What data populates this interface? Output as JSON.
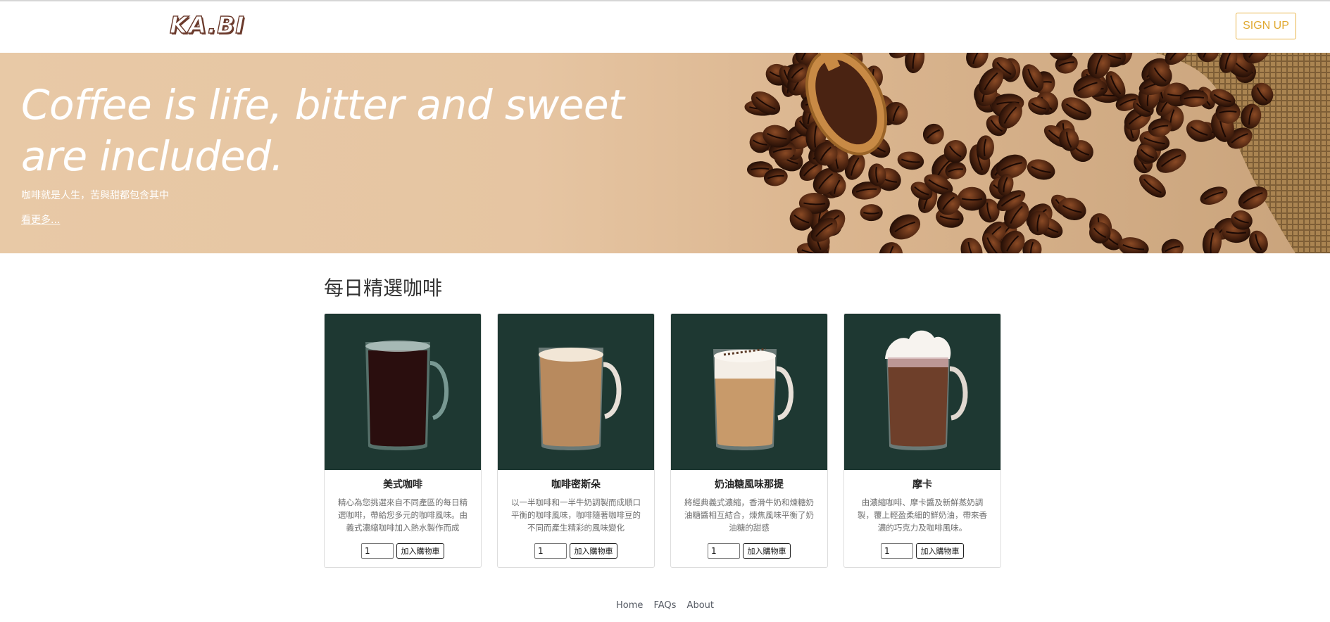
{
  "header": {
    "logo": "KA.BI",
    "signup_label": "SIGN UP"
  },
  "hero": {
    "title": "Coffee is life, bitter and sweet are included.",
    "subtitle": "咖啡就是人生，苦與甜都包含其中",
    "more_link": "看更多..."
  },
  "section": {
    "title": "每日精選咖啡"
  },
  "products": [
    {
      "name": "美式咖啡",
      "description": "精心為您挑選來自不同產區的每日精選咖啡，帶給您多元的咖啡風味。由義式濃縮咖啡加入熱水製作而成",
      "quantity": "1",
      "button": "加入購物車",
      "drink_color": "#2a0e0e"
    },
    {
      "name": "咖啡密斯朵",
      "description": "以一半咖啡和一半牛奶調製而成順口平衡的咖啡風味，咖啡隨著咖啡豆的不同而產生精彩的風味變化",
      "quantity": "1",
      "button": "加入購物車",
      "drink_color": "#b88a5e"
    },
    {
      "name": "奶油糖風味那提",
      "description": "將經典義式濃縮，香滑牛奶和煉糖奶油糖醬相互結合，煉焦風味平衡了奶油糖的甜感",
      "quantity": "1",
      "button": "加入購物車",
      "drink_color": "#c89a6a"
    },
    {
      "name": "摩卡",
      "description": "由濃縮咖啡、摩卡醬及新鮮蒸奶調製，覆上輕盈柔細的鮮奶油，帶來香濃的巧克力及咖啡風味。",
      "quantity": "1",
      "button": "加入購物車",
      "drink_color": "#6e3f2a"
    }
  ],
  "footer": {
    "links": [
      "Home",
      "FAQs",
      "About"
    ]
  },
  "colors": {
    "accent": "#e0a930",
    "card_bg": "#1e3832",
    "hero_bg": "#e6c5a2"
  }
}
